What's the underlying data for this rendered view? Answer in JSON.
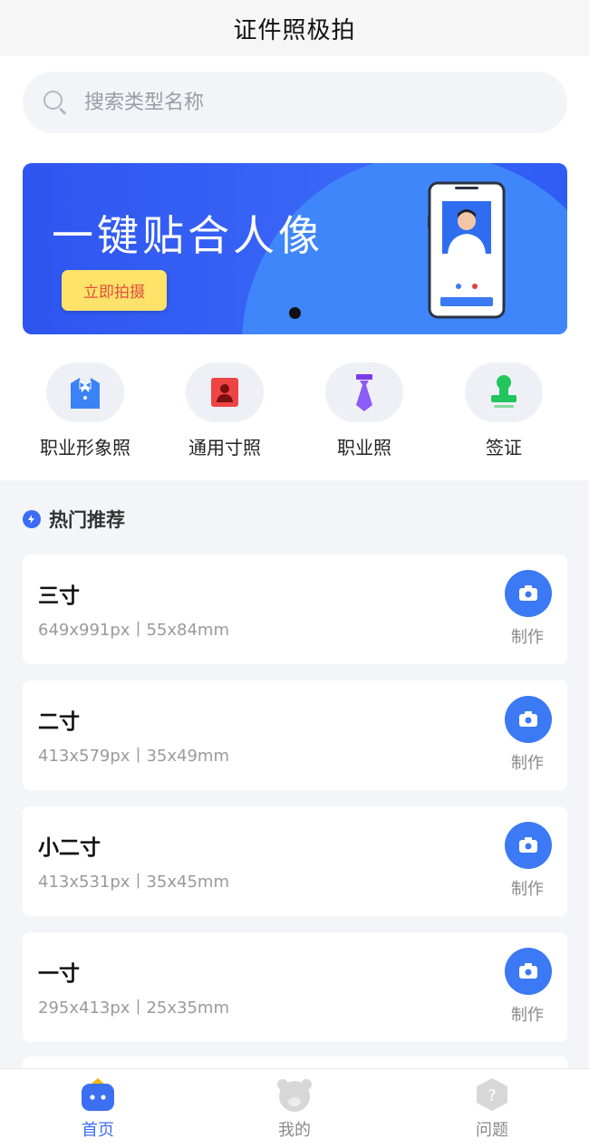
{
  "header": {
    "title": "证件照极拍"
  },
  "search": {
    "placeholder": "搜索类型名称"
  },
  "banner": {
    "headline": "一键贴合人像",
    "cta_label": "立即拍摄"
  },
  "categories": [
    {
      "label": "职业形象照",
      "icon": "suit-icon"
    },
    {
      "label": "通用寸照",
      "icon": "portrait-icon"
    },
    {
      "label": "职业照",
      "icon": "tie-icon"
    },
    {
      "label": "签证",
      "icon": "stamp-icon"
    }
  ],
  "section": {
    "title": "热门推荐"
  },
  "sizes": [
    {
      "name": "三寸",
      "spec": "649x991px丨55x84mm",
      "action": "制作"
    },
    {
      "name": "二寸",
      "spec": "413x579px丨35x49mm",
      "action": "制作"
    },
    {
      "name": "小二寸",
      "spec": "413x531px丨35x45mm",
      "action": "制作"
    },
    {
      "name": "一寸",
      "spec": "295x413px丨25x35mm",
      "action": "制作"
    }
  ],
  "tabbar": {
    "items": [
      {
        "label": "首页",
        "active": true
      },
      {
        "label": "我的",
        "active": false
      },
      {
        "label": "问题",
        "active": false
      }
    ]
  },
  "colors": {
    "accent": "#3c79f4",
    "banner": "#2f55f0",
    "cta": "#ffe26a"
  }
}
